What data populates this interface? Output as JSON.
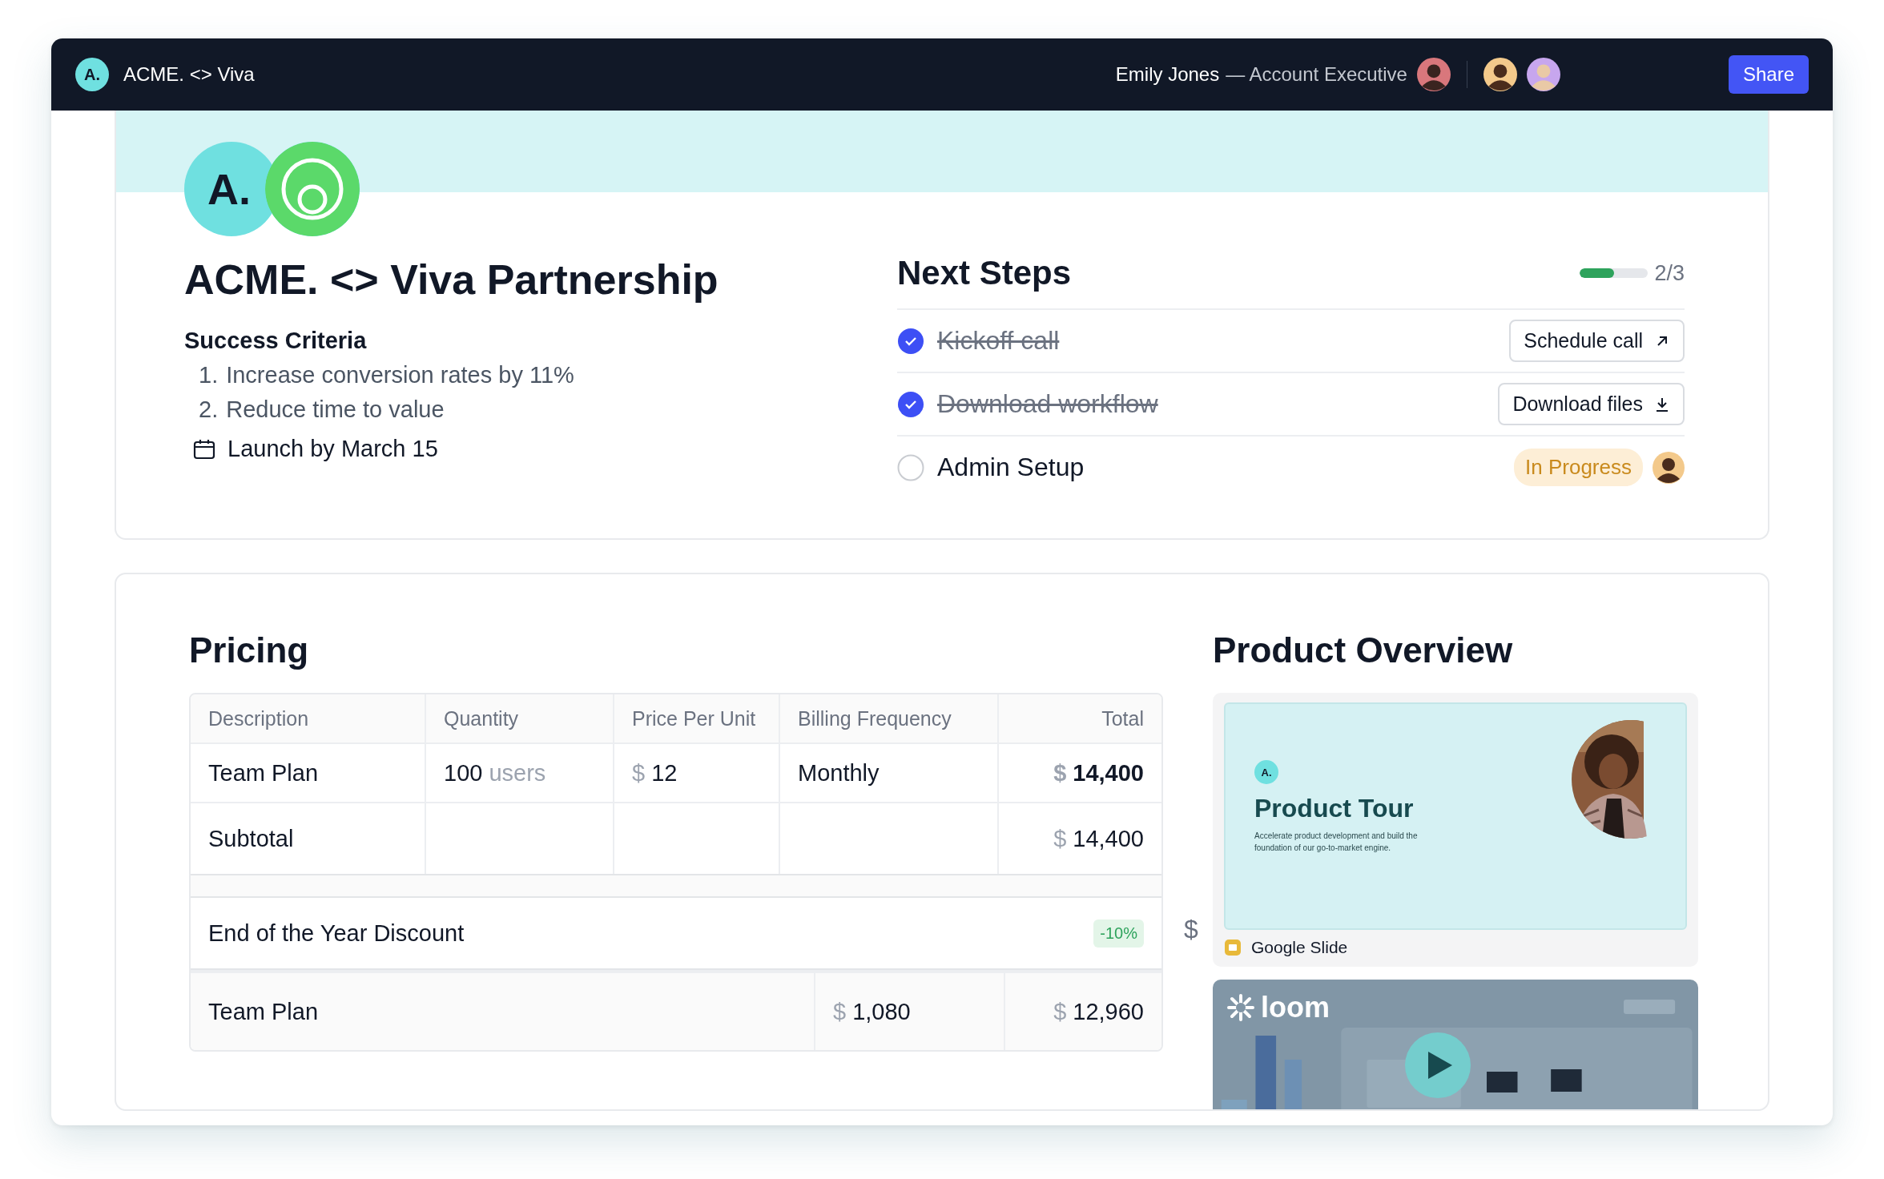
{
  "topbar": {
    "logo": "A.",
    "title": "ACME. <> Viva",
    "user_name": "Emily Jones",
    "user_role": "— Account Executive",
    "share": "Share"
  },
  "header": {
    "logo": "A.",
    "title": "ACME. <> Viva Partnership"
  },
  "success_criteria": {
    "heading": "Success Criteria",
    "items": [
      {
        "number": "1.",
        "text": "Increase conversion rates by 11%"
      },
      {
        "number": "2.",
        "text": "Reduce time to value"
      }
    ],
    "launch": "Launch by March 15"
  },
  "next_steps": {
    "title": "Next Steps",
    "progress": {
      "level": 0.5,
      "reading": "2/3"
    },
    "steps": [
      {
        "label": "Kickoff call",
        "checked": true,
        "kind": "external",
        "action": "Schedule call"
      },
      {
        "label": "Download workflow",
        "checked": true,
        "kind": "download",
        "action": "Download files"
      },
      {
        "label": "Admin Setup",
        "checked": false,
        "kind": "status",
        "action": "In Progress"
      }
    ]
  },
  "pricing": {
    "title": "Pricing",
    "columns": [
      "Description",
      "Quantity",
      "Price Per Unit",
      "Billing Frequency",
      "Total"
    ],
    "rows": [
      {
        "description": "Team Plan",
        "quantity": "100",
        "unit": "users",
        "price": {
          "currency": "$",
          "amount": "12"
        },
        "billing": "Monthly",
        "total": {
          "currency": "$",
          "amount": "14,400"
        }
      }
    ],
    "subtotal": {
      "label": "Subtotal",
      "total": {
        "currency": "$",
        "amount": "14,400"
      }
    },
    "discount": {
      "label": "End of the Year Discount",
      "badge": "-10%"
    },
    "discounted": {
      "label": "Team Plan",
      "amount": {
        "currency": "$",
        "amount": "1,080"
      },
      "total": {
        "currency": "$",
        "amount": "12,960"
      }
    }
  },
  "product_overview": {
    "title": "Product Overview",
    "side_mark": "$",
    "slide": {
      "logo": "A.",
      "title": "Product Tour",
      "text": "Accelerate product development and build the foundation of our go-to-market engine.",
      "source": "Google Slide"
    },
    "video": {
      "logo": "loom"
    }
  }
}
